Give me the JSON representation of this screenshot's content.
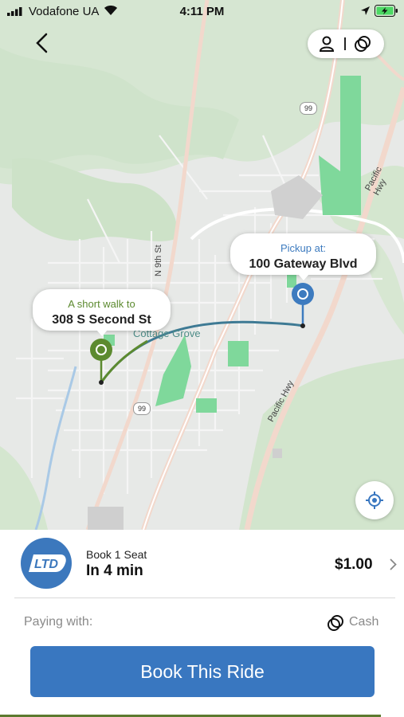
{
  "status_bar": {
    "carrier": "Vodafone UA",
    "time": "4:11 PM"
  },
  "map": {
    "town_label": "Cottage Grove",
    "road_labels": {
      "n9th": "N 9th St",
      "pacific_hwy_top": "Pacific Hwy",
      "pacific_hwy_bottom": "Pacific Hwy",
      "route_99_top": "99",
      "route_99_bottom": "99"
    },
    "walk_callout": {
      "subtitle": "A short walk to",
      "address": "308 S Second St"
    },
    "pickup_callout": {
      "subtitle": "Pickup at:",
      "address": "100 Gateway Blvd"
    },
    "colors": {
      "walk_green": "#5c8a2f",
      "pickup_blue": "#3d7bbf",
      "park_green": "#7fd89b"
    }
  },
  "icons": {
    "back": "chevron-left-icon",
    "profile": "person-icon",
    "payment": "cash-circles-icon",
    "locate": "crosshair-icon"
  },
  "ride": {
    "seat_label": "Book 1 Seat",
    "eta": "In 4 min",
    "price": "$1.00",
    "logo_text": "LTD"
  },
  "payment": {
    "label": "Paying with:",
    "method": "Cash"
  },
  "actions": {
    "book_button": "Book This Ride"
  },
  "accent_color": "#3977c0"
}
